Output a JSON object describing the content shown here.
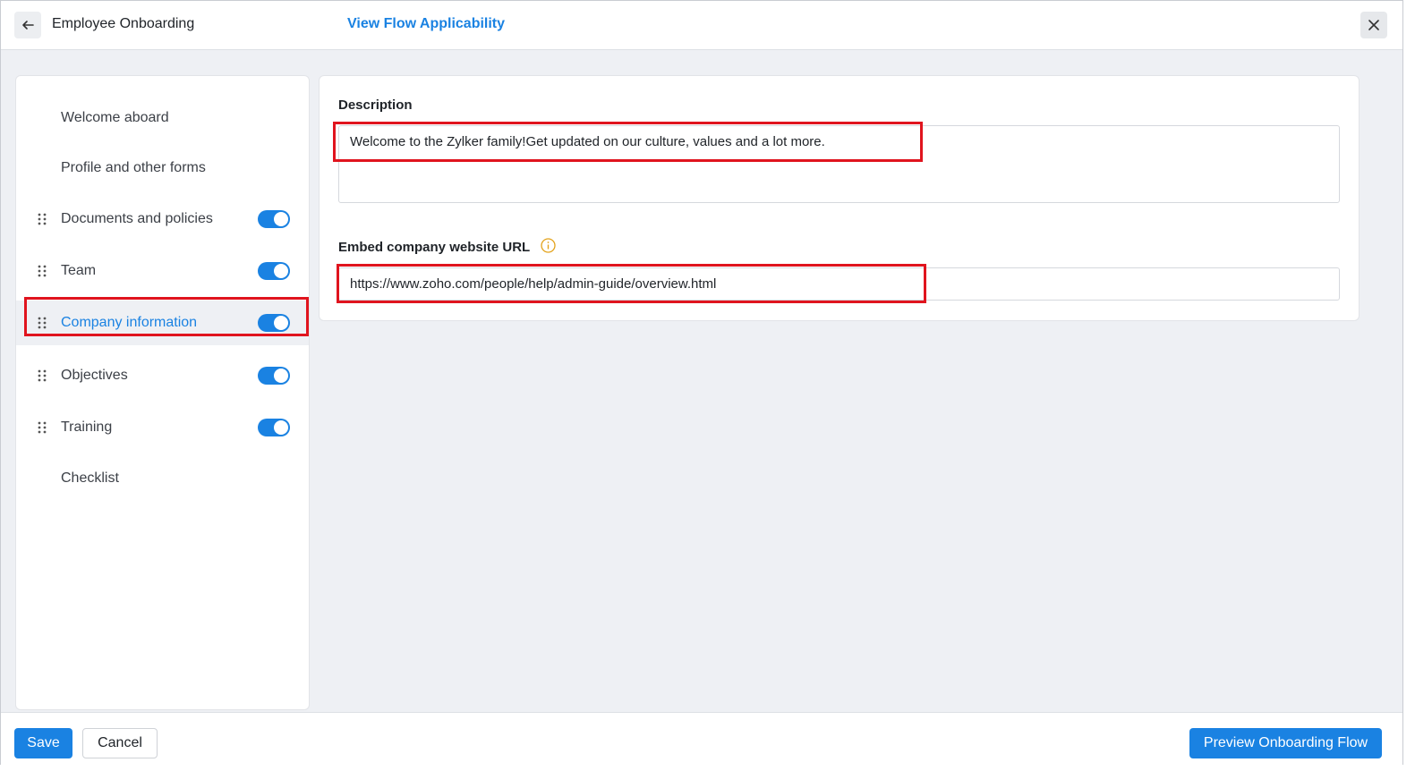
{
  "header": {
    "title": "Employee Onboarding",
    "view_link": "View Flow Applicability"
  },
  "sidebar": {
    "items": [
      {
        "label": "Welcome aboard",
        "draggable": false,
        "toggle": null
      },
      {
        "label": "Profile and other forms",
        "draggable": false,
        "toggle": null
      },
      {
        "label": "Documents and policies",
        "draggable": true,
        "toggle": true
      },
      {
        "label": "Team",
        "draggable": true,
        "toggle": true
      },
      {
        "label": "Company information",
        "draggable": true,
        "toggle": true,
        "active": true
      },
      {
        "label": "Objectives",
        "draggable": true,
        "toggle": true
      },
      {
        "label": "Training",
        "draggable": true,
        "toggle": true
      },
      {
        "label": "Checklist",
        "draggable": false,
        "toggle": null
      }
    ]
  },
  "form": {
    "description_label": "Description",
    "description_value": "Welcome to the Zylker family!Get updated on our culture, values and a lot more.",
    "url_label": "Embed company website URL",
    "url_value": "https://www.zoho.com/people/help/admin-guide/overview.html"
  },
  "footer": {
    "save_label": "Save",
    "cancel_label": "Cancel",
    "preview_label": "Preview Onboarding Flow"
  },
  "colors": {
    "accent": "#1a82e2",
    "highlight": "#e0141e",
    "background": "#eef0f4"
  }
}
